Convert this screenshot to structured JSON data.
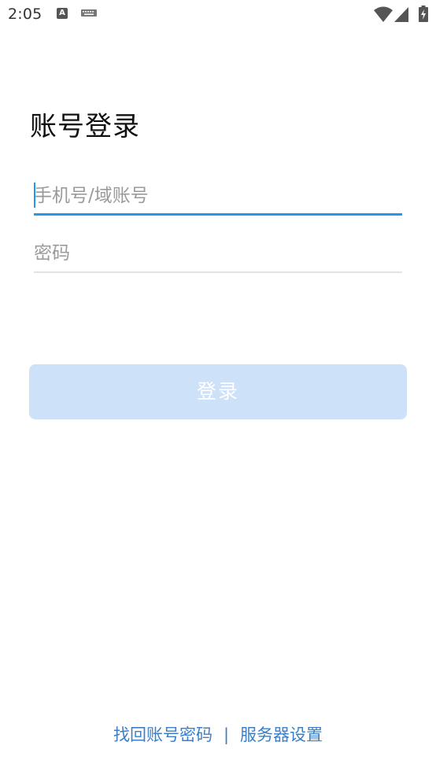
{
  "status_bar": {
    "time": "2:05",
    "icons": [
      "font-icon",
      "keyboard-icon",
      "wifi-icon",
      "signal-icon",
      "battery-icon"
    ]
  },
  "login": {
    "title": "账号登录",
    "phone_placeholder": "手机号/域账号",
    "phone_value": "",
    "password_placeholder": "密码",
    "password_value": "",
    "submit_label": "登录"
  },
  "footer": {
    "forgot_label": "找回账号密码",
    "divider": "|",
    "server_settings_label": "服务器设置"
  },
  "colors": {
    "accent": "#1e9ae8",
    "button_disabled": "#cde1f9",
    "link": "#3a7fc8"
  }
}
